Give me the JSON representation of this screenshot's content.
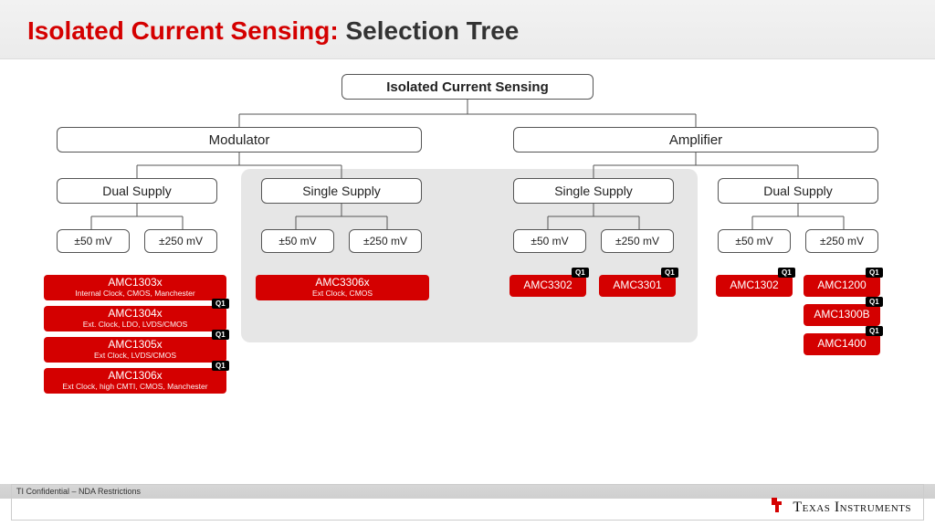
{
  "title": {
    "red": "Isolated Current Sensing:",
    "black": " Selection Tree"
  },
  "root": "Isolated Current Sensing",
  "cats": {
    "modulator": "Modulator",
    "amplifier": "Amplifier"
  },
  "subs": {
    "dual": "Dual Supply",
    "single": "Single Supply"
  },
  "ranges": {
    "r50": "±50 mV",
    "r250": "±250 mV"
  },
  "chips": {
    "amc1303x": {
      "name": "AMC1303x",
      "sub": "Internal Clock, CMOS, Manchester"
    },
    "amc1304x": {
      "name": "AMC1304x",
      "sub": "Ext. Clock, LDO, LVDS/CMOS"
    },
    "amc1305x": {
      "name": "AMC1305x",
      "sub": "Ext Clock, LVDS/CMOS"
    },
    "amc1306x": {
      "name": "AMC1306x",
      "sub": "Ext Clock, high CMTI, CMOS, Manchester"
    },
    "amc3306x": {
      "name": "AMC3306x",
      "sub": "Ext Clock, CMOS"
    },
    "amc3302": {
      "name": "AMC3302"
    },
    "amc3301": {
      "name": "AMC3301"
    },
    "amc1302": {
      "name": "AMC1302"
    },
    "amc1200": {
      "name": "AMC1200"
    },
    "amc1300b": {
      "name": "AMC1300B"
    },
    "amc1400": {
      "name": "AMC1400"
    }
  },
  "q1": "Q1",
  "footer": "TI Confidential – NDA Restrictions",
  "brand": "Texas Instruments"
}
